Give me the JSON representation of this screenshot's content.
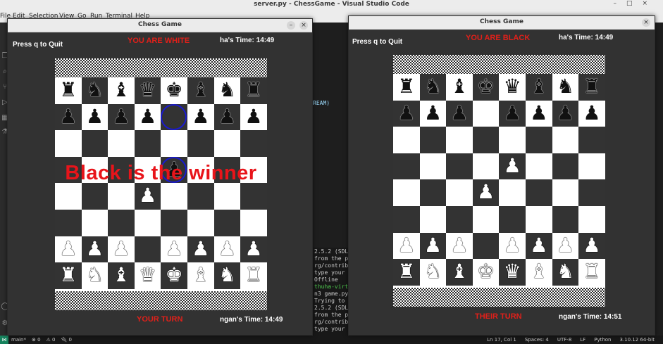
{
  "vscode": {
    "title": "server.py - ChessGame - Visual Studio Code",
    "menu": [
      "File",
      "Edit",
      "Selection",
      "View",
      "Go",
      "Run",
      "Terminal",
      "Help"
    ],
    "editor_snippet": "REAM)",
    "terminal_lines": [
      "2.5.2 (SDL",
      "from the py",
      "rg/contribu",
      " type your",
      " Offline",
      "thuha-virtu",
      "n3 game.py",
      " Trying to",
      "2.5.2 (SDL",
      "from the py",
      "rg/contribu",
      " type your"
    ],
    "status": {
      "branch": "main*",
      "errors": "⊗ 0",
      "warnings": "⚠ 0",
      "ports": "🔌 0",
      "position": "Ln 17, Col 1",
      "spaces": "Spaces: 4",
      "encoding": "UTF-8",
      "eol": "LF",
      "language": "Python",
      "interpreter": "3.10.12 64-bit"
    }
  },
  "left_window": {
    "title": "Chess Game",
    "quit_hint": "Press q to Quit",
    "side": "YOU ARE WHITE",
    "opponent_time": "ha's Time: 14:49",
    "turn": "YOUR TURN",
    "own_time": "ngan's Time: 14:49",
    "winner": "Black is the winner",
    "minimize_symbol": "–",
    "close_symbol": "×"
  },
  "right_window": {
    "title": "Chess Game",
    "quit_hint": "Press q to Quit",
    "side": "YOU ARE BLACK",
    "opponent_time": "ha's Time: 14:49",
    "turn": "THEIR TURN",
    "own_time": "ngan's Time: 14:51",
    "close_symbol": "×"
  },
  "boards": {
    "left": [
      "rnbqkbnr",
      "pppp.ppp",
      "........",
      "....p...",
      "...P....",
      "........",
      "PPP.PPPP",
      "RNBQKBNR"
    ],
    "left_highlights": [
      [
        1,
        4
      ],
      [
        3,
        4
      ]
    ],
    "right": [
      "rnbkqbnr",
      "ppp.pppp",
      "........",
      "....P...",
      "...P....",
      "........",
      "PPP.PPPP",
      "RNBKQBNR"
    ]
  },
  "colors": {
    "hud_red": "#e0201a",
    "winner_red": "#e8141a",
    "highlight_blue": "#1a1acf",
    "dark_square": "#333333",
    "light_square": "#ffffff"
  }
}
